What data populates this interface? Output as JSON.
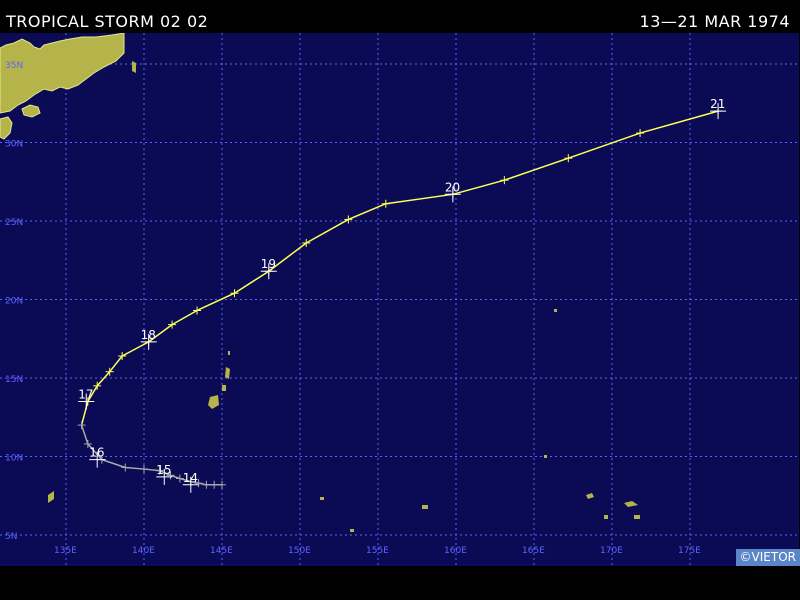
{
  "header": {
    "title": "TROPICAL STORM 02 02",
    "dates": "13—21 MAR 1974"
  },
  "map": {
    "background_color": "#0b0b55",
    "grid_color": "#5a64ff",
    "land_color": "#b4b44a",
    "lat_labels": [
      "5N",
      "10N",
      "15N",
      "20N",
      "25N",
      "30N",
      "35N"
    ],
    "lon_labels": [
      "135E",
      "140E",
      "145E",
      "150E",
      "155E",
      "160E",
      "165E",
      "170E",
      "175E"
    ]
  },
  "track": {
    "depression_color": "#a8a8a8",
    "storm_color": "#ffff55",
    "day_labels": [
      {
        "label": "14",
        "lat": 8.2,
        "lon": 143.0
      },
      {
        "label": "15",
        "lat": 8.7,
        "lon": 141.3
      },
      {
        "label": "16",
        "lat": 9.8,
        "lon": 137.0
      },
      {
        "label": "17",
        "lat": 13.5,
        "lon": 136.3
      },
      {
        "label": "18",
        "lat": 17.3,
        "lon": 140.3
      },
      {
        "label": "19",
        "lat": 21.8,
        "lon": 148.0
      },
      {
        "label": "20",
        "lat": 26.7,
        "lon": 159.8
      },
      {
        "label": "21",
        "lat": 32.0,
        "lon": 176.8
      }
    ],
    "points": [
      {
        "lat": 8.2,
        "lon": 145.0,
        "stage": "depression"
      },
      {
        "lat": 8.2,
        "lon": 144.5,
        "stage": "depression"
      },
      {
        "lat": 8.2,
        "lon": 144.0,
        "stage": "depression"
      },
      {
        "lat": 8.3,
        "lon": 143.5,
        "stage": "depression"
      },
      {
        "lat": 8.4,
        "lon": 143.0,
        "stage": "depression"
      },
      {
        "lat": 8.6,
        "lon": 142.3,
        "stage": "depression"
      },
      {
        "lat": 8.8,
        "lon": 141.7,
        "stage": "depression"
      },
      {
        "lat": 9.1,
        "lon": 141.0,
        "stage": "depression"
      },
      {
        "lat": 9.2,
        "lon": 140.0,
        "stage": "depression"
      },
      {
        "lat": 9.3,
        "lon": 138.8,
        "stage": "depression"
      },
      {
        "lat": 9.8,
        "lon": 137.3,
        "stage": "depression"
      },
      {
        "lat": 10.8,
        "lon": 136.4,
        "stage": "depression"
      },
      {
        "lat": 12.0,
        "lon": 136.0,
        "stage": "depression"
      },
      {
        "lat": 13.5,
        "lon": 136.4,
        "stage": "storm"
      },
      {
        "lat": 14.5,
        "lon": 137.0,
        "stage": "storm"
      },
      {
        "lat": 15.4,
        "lon": 137.8,
        "stage": "storm"
      },
      {
        "lat": 16.4,
        "lon": 138.6,
        "stage": "storm"
      },
      {
        "lat": 17.3,
        "lon": 140.3,
        "stage": "storm"
      },
      {
        "lat": 18.4,
        "lon": 141.8,
        "stage": "storm"
      },
      {
        "lat": 19.3,
        "lon": 143.4,
        "stage": "storm"
      },
      {
        "lat": 20.4,
        "lon": 145.8,
        "stage": "storm"
      },
      {
        "lat": 21.8,
        "lon": 148.0,
        "stage": "storm"
      },
      {
        "lat": 23.6,
        "lon": 150.4,
        "stage": "storm"
      },
      {
        "lat": 25.1,
        "lon": 153.1,
        "stage": "storm"
      },
      {
        "lat": 26.1,
        "lon": 155.5,
        "stage": "storm"
      },
      {
        "lat": 26.7,
        "lon": 159.8,
        "stage": "storm"
      },
      {
        "lat": 27.6,
        "lon": 163.1,
        "stage": "storm"
      },
      {
        "lat": 29.0,
        "lon": 167.2,
        "stage": "storm"
      },
      {
        "lat": 30.6,
        "lon": 171.8,
        "stage": "storm"
      },
      {
        "lat": 32.0,
        "lon": 176.8,
        "stage": "storm"
      }
    ]
  },
  "credit": "©VIETOR"
}
